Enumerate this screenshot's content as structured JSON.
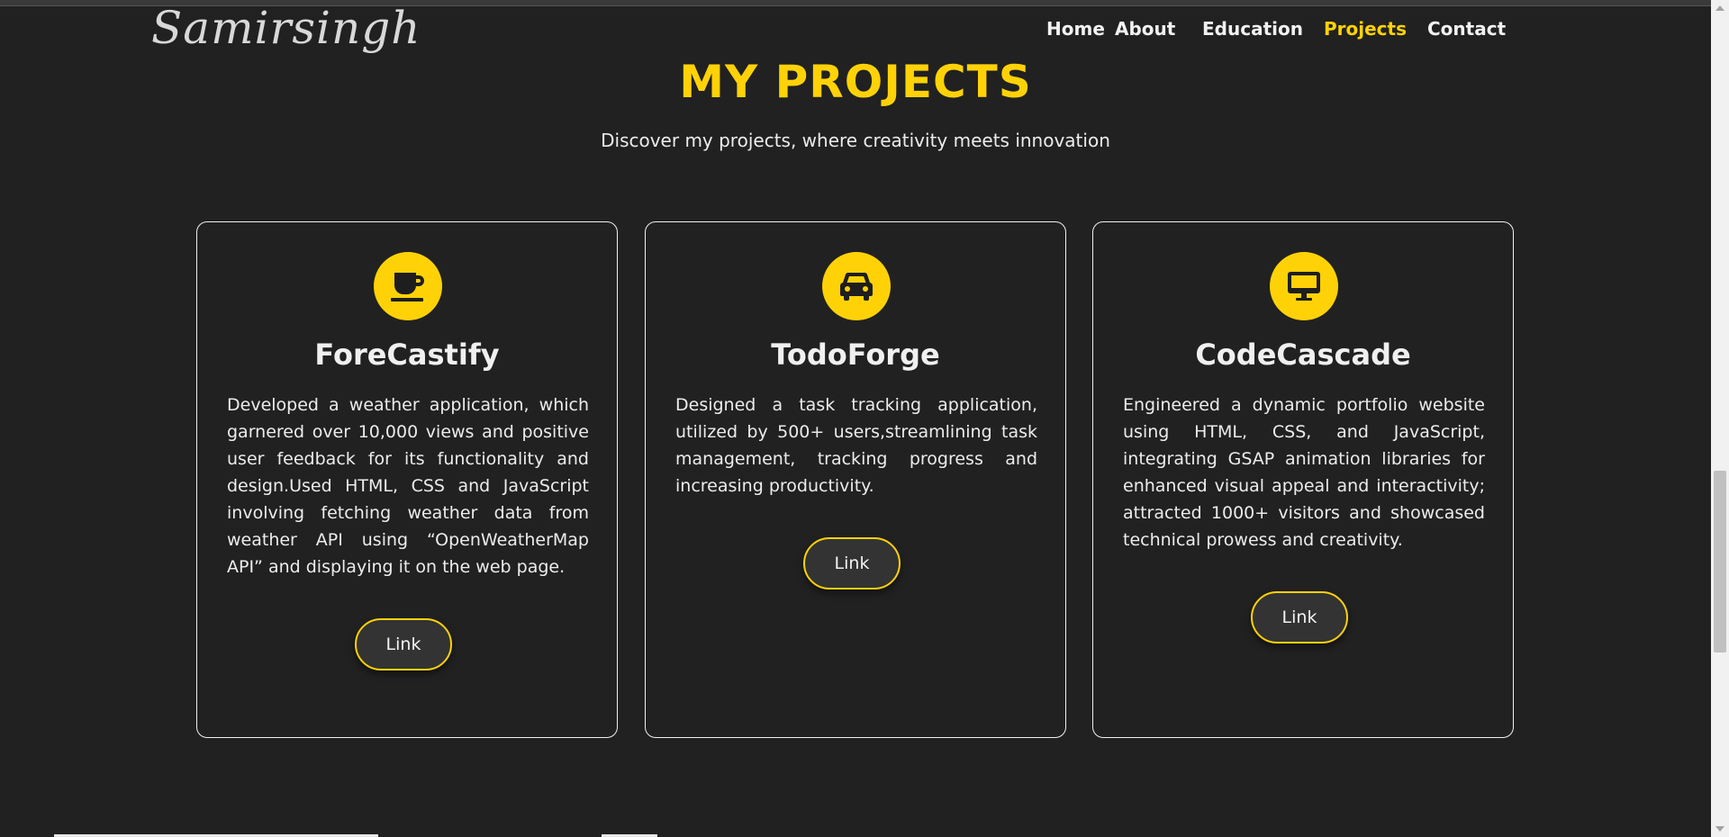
{
  "brand": {
    "logo_text": "Samirsingh"
  },
  "nav": {
    "items": [
      {
        "label": "Home",
        "active": false
      },
      {
        "label": "About",
        "active": false
      },
      {
        "label": "Education",
        "active": false
      },
      {
        "label": "Projects",
        "active": true
      },
      {
        "label": "Contact",
        "active": false
      }
    ]
  },
  "section": {
    "title": "MY PROJECTS",
    "subtitle": "Discover my projects, where creativity meets innovation"
  },
  "projects": [
    {
      "icon": "coffee-cup-icon",
      "title": "ForeCastify",
      "description": "Developed a weather application, which garnered over 10,000 views and positive user feedback for its functionality and design.Used HTML, CSS and JavaScript involving fetching weather data from weather API using “OpenWeatherMap API” and displaying it on the web page.",
      "link_label": "Link"
    },
    {
      "icon": "car-icon",
      "title": "TodoForge",
      "description": "Designed a task tracking application, utilized by 500+ users,streamlining task management, tracking progress and increasing productivity.",
      "link_label": "Link"
    },
    {
      "icon": "desktop-monitor-icon",
      "title": "CodeCascade",
      "description": "Engineered a dynamic portfolio website using HTML, CSS, and JavaScript, integrating GSAP animation libraries for enhanced visual appeal and interactivity; attracted 1000+ visitors and showcased technical prowess and creativity.",
      "link_label": "Link"
    }
  ],
  "colors": {
    "background": "#212121",
    "accent": "#ffd207",
    "card_border": "#f0f0f0",
    "button_bg": "#333333"
  }
}
